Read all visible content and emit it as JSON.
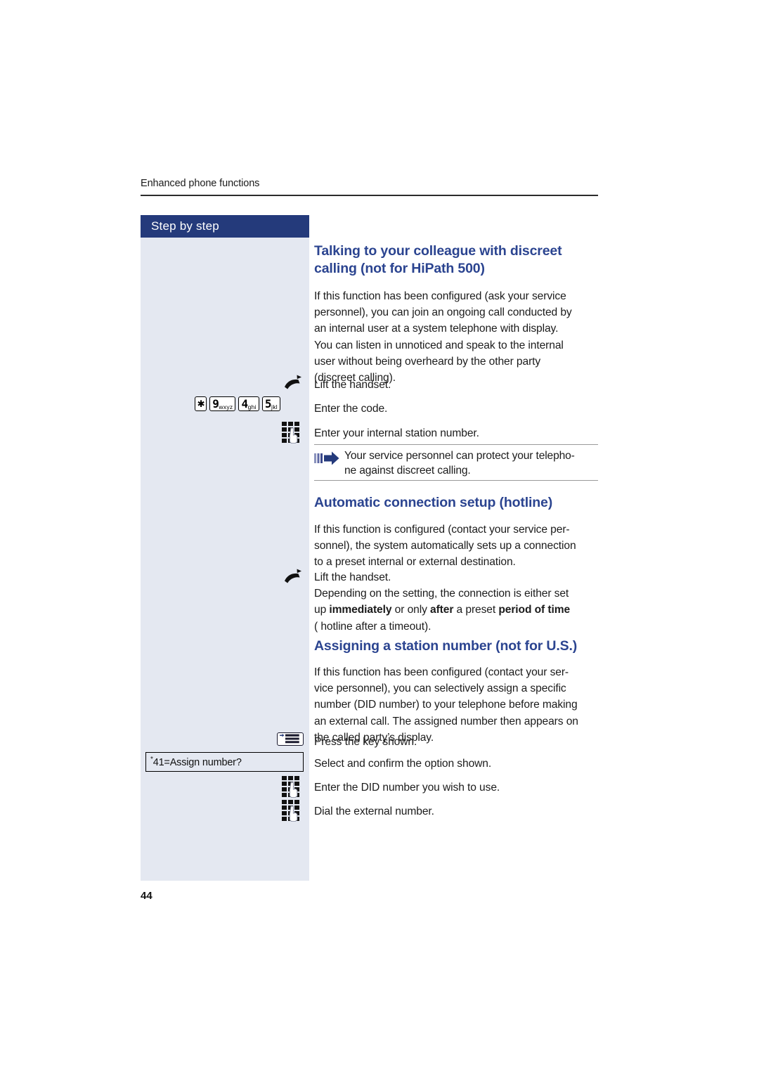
{
  "page": {
    "running_header": "Enhanced phone functions",
    "number": "44"
  },
  "sidebar": {
    "title": "Step by step"
  },
  "sections": [
    {
      "id": "discreet-calling",
      "heading_line1": "Talking to your colleague with discreet",
      "heading_line2": "calling (not for HiPath 500)",
      "body_lines": [
        "If this function has been configured (ask your service",
        "personnel), you can join an ongoing call conducted by",
        "an internal user at a system telephone with display.",
        "You can listen in unnoticed and speak to the internal",
        "user without being overheard by the other party",
        "(discreet calling)."
      ],
      "steps": [
        {
          "icon": "handset-lift-icon",
          "text": "Lift the handset."
        },
        {
          "icon": "keycaps-icon",
          "text": "Enter the code."
        },
        {
          "icon": "keypad-dial-icon",
          "text": "Enter your internal station number."
        }
      ],
      "note": {
        "icon": "note-arrow-icon",
        "line1": "Your service personnel can protect your telepho-",
        "line2": "ne against discreet calling."
      }
    },
    {
      "id": "automatic-connection-setup",
      "heading_line1": "Automatic connection setup (hotline)",
      "body_lines": [
        "If this function is configured (contact your service per-",
        "sonnel), the system automatically sets up a connection",
        "to a preset internal or external destination."
      ],
      "steps": [
        {
          "icon": "handset-lift-icon",
          "text": "Lift the handset."
        }
      ],
      "trailing_lines": [
        "Depending on the setting, the connection is either set"
      ],
      "emphasis_line": {
        "a": "up ",
        "b_bold": "immediately",
        "c": " or only ",
        "d_bold": "after",
        "e": " a preset ",
        "f_bold": "period of time"
      },
      "last_line": "( hotline after a timeout)."
    },
    {
      "id": "assigning-station-number",
      "heading_line1": "Assigning a station number (not for U.S.)",
      "body_lines": [
        "If this function has been configured (contact your ser-",
        "vice personnel), you can selectively assign a specific",
        "number (DID number) to your telephone before making",
        "an external call. The assigned number then appears on",
        "the called party’s display."
      ],
      "steps": [
        {
          "icon": "menu-key-icon",
          "text": "Press the key shown."
        },
        {
          "icon": "display-option-icon",
          "text": "Select and confirm the option shown."
        },
        {
          "icon": "keypad-dial-icon",
          "text": "Enter the DID number you wish to use."
        },
        {
          "icon": "keypad-dial-icon",
          "text": "Dial the external number."
        }
      ],
      "display_option": {
        "prefix": "*",
        "label": "41=Assign number?"
      }
    }
  ],
  "keycaps": [
    {
      "digit": "✱",
      "sub": ""
    },
    {
      "digit": "9",
      "sub": "wxyz"
    },
    {
      "digit": "4",
      "sub": "ghi"
    },
    {
      "digit": "5",
      "sub": "jkl"
    }
  ],
  "colors": {
    "heading_blue": "#2b4490",
    "sidebar_bg": "#e4e8f1",
    "sidebar_title_bg": "#243a7b",
    "note_arrow": "#243a7b"
  }
}
